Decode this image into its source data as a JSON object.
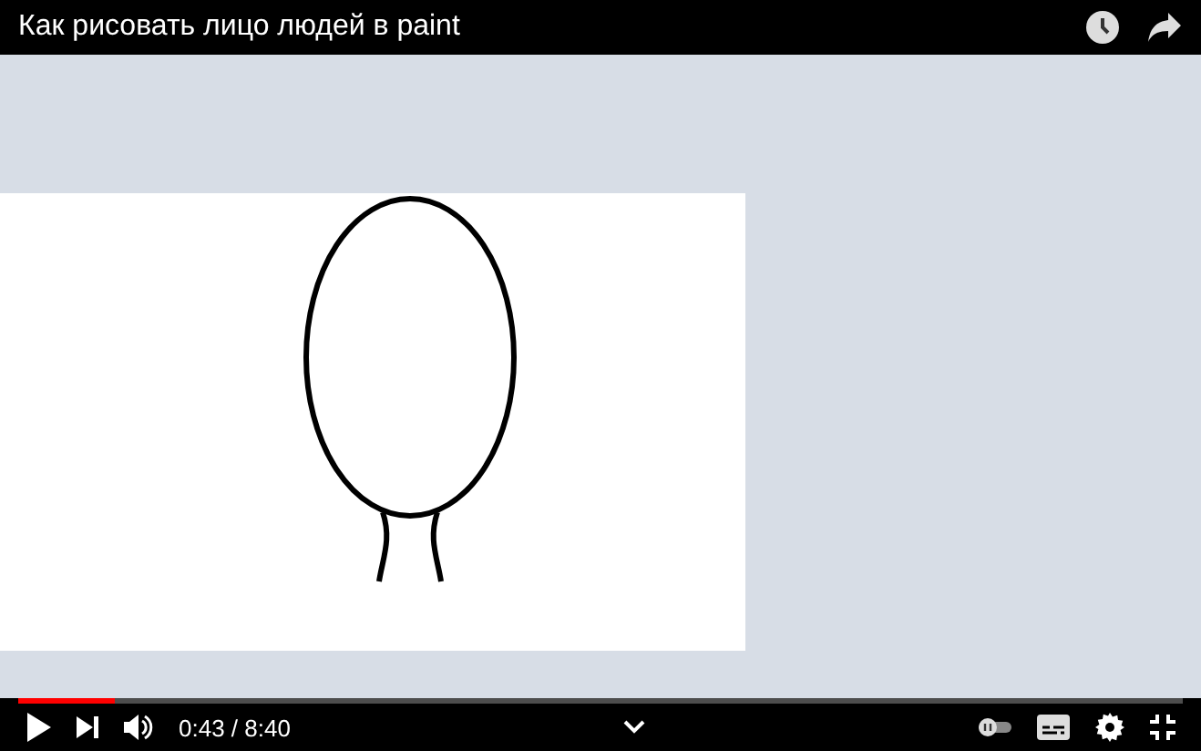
{
  "title_bar": {
    "title": "Как рисовать лицо людей в paint"
  },
  "player": {
    "progress": {
      "level": 0.083
    },
    "autoplay": {
      "on": false
    },
    "time": "0:43 / 8:40"
  }
}
